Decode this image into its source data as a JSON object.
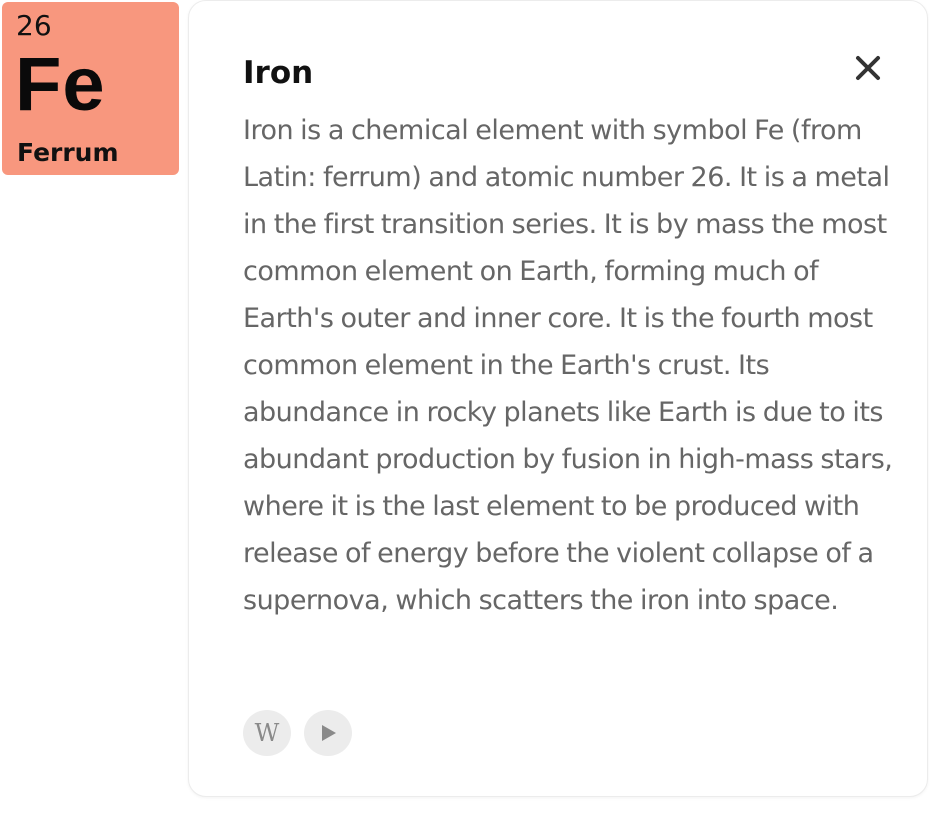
{
  "element": {
    "atomic_number": "26",
    "symbol": "Fe",
    "latin_name": "Ferrum",
    "tile_color": "#f8977e"
  },
  "card": {
    "title": "Iron",
    "description": "Iron is a chemical element with symbol Fe (from Latin: ferrum) and atomic number 26. It is a metal in the first transition series. It is by mass the most common element on Earth, forming much of Earth's outer and inner core. It is the fourth most common element in the Earth's crust. Its abundance in rocky planets like Earth is due to its abundant production by fusion in high-mass stars, where it is the last element to be produced with release of energy before the violent collapse of a supernova, which scatters the iron into space.",
    "close_icon": "close-icon",
    "wikipedia_icon": "wikipedia-icon",
    "wikipedia_glyph": "W",
    "play_icon": "play-icon"
  }
}
